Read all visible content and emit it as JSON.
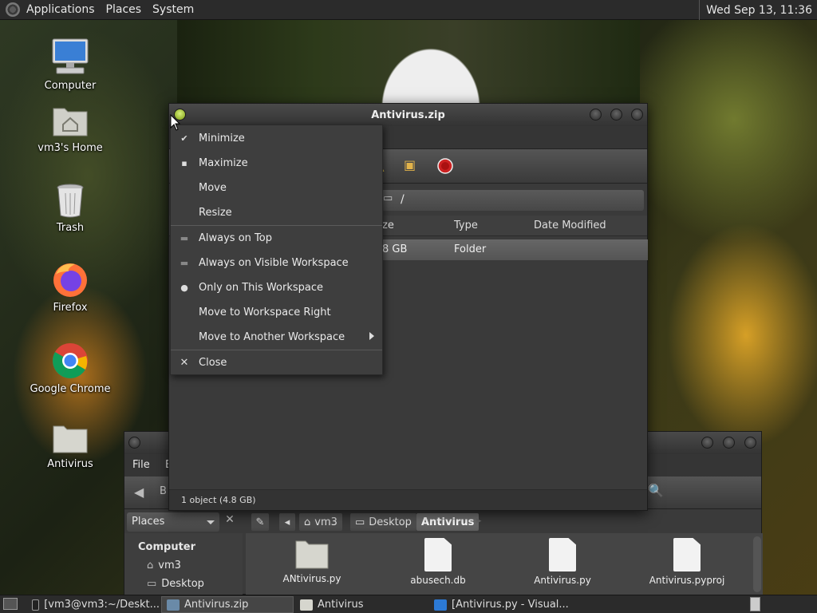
{
  "top_panel": {
    "menus": [
      "Applications",
      "Places",
      "System"
    ],
    "clock": "Wed Sep 13, 11:36"
  },
  "desktop_icons": [
    {
      "label": "Computer",
      "icon": "computer-icon"
    },
    {
      "label": "vm3's Home",
      "icon": "home-folder-icon"
    },
    {
      "label": "Trash",
      "icon": "trash-icon"
    },
    {
      "label": "Firefox",
      "icon": "firefox-icon"
    },
    {
      "label": "Google Chrome",
      "icon": "chrome-icon"
    },
    {
      "label": "Antivirus",
      "icon": "folder-icon"
    }
  ],
  "main_window": {
    "title": "Antivirus.zip",
    "location": "/",
    "columns": [
      "ze",
      "Type",
      "Date Modified"
    ],
    "row": {
      "size": "8 GB",
      "type": "Folder"
    },
    "status": "1 object (4.8 GB)"
  },
  "context_menu": {
    "items": [
      {
        "label": "Minimize",
        "mark": "check"
      },
      {
        "label": "Maximize",
        "mark": "square"
      },
      {
        "label": "Move",
        "mark": ""
      },
      {
        "label": "Resize",
        "mark": ""
      },
      {
        "label": "Always on Top",
        "mark": "dash"
      },
      {
        "label": "Always on Visible Workspace",
        "mark": "dash"
      },
      {
        "label": "Only on This Workspace",
        "mark": "dot"
      },
      {
        "label": "Move to Workspace Right",
        "mark": ""
      },
      {
        "label": "Move to Another Workspace",
        "mark": "",
        "submenu": true
      },
      {
        "label": "Close",
        "mark": "x"
      }
    ]
  },
  "back_window": {
    "menu": [
      "File",
      "E"
    ],
    "back_label": "B",
    "places_label": "Places",
    "breadcrumbs": [
      "vm3",
      "Desktop",
      "Antivirus"
    ],
    "sidebar": {
      "header": "Computer",
      "items": [
        "vm3",
        "Desktop"
      ]
    },
    "files": [
      "ANtivirus.py",
      "abusech.db",
      "Antivirus.py",
      "Antivirus.pyproj"
    ]
  },
  "taskbar": {
    "items": [
      {
        "label": "[vm3@vm3:~/Deskt...",
        "active": false
      },
      {
        "label": "Antivirus.zip",
        "active": true
      },
      {
        "label": "Antivirus",
        "active": false
      },
      {
        "label": "[Antivirus.py - Visual...",
        "active": false
      }
    ]
  },
  "colors": {
    "panel": "#2b2b2b",
    "window": "#3a3a3a",
    "menu": "#3e3e3e",
    "accent_green": "#b9d84a"
  }
}
